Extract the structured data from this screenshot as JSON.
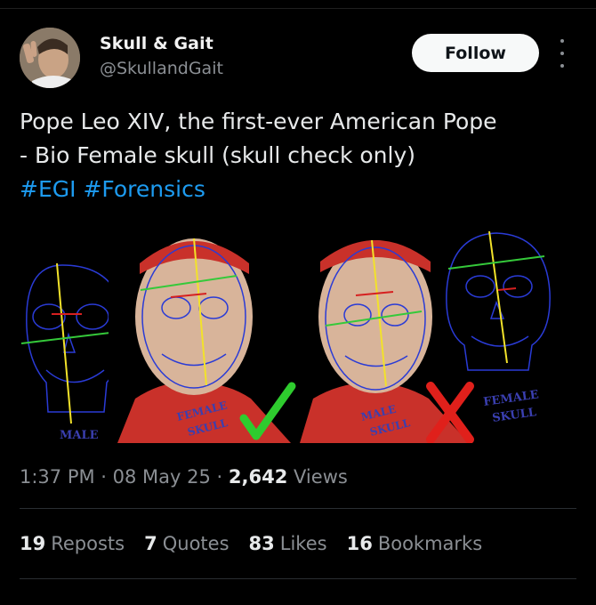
{
  "author": {
    "name": "Skull & Gait",
    "handle": "@SkullandGait"
  },
  "follow_label": "Follow",
  "tweet": {
    "line1": "Pope Leo XIV, the first-ever American Pope",
    "line2": "- Bio Female skull (skull check only)",
    "hashtags": [
      "#EGI",
      "#Forensics"
    ]
  },
  "media": {
    "left_skull_label": "MALE",
    "face1_label_top": "FEMALE",
    "face1_label_bottom": "SKULL",
    "face2_label_top": "MALE",
    "face2_label_bottom": "SKULL",
    "right_skull_label_top": "FEMALE",
    "right_skull_label_bottom": "SKULL",
    "face1_mark": "checkmark",
    "face2_mark": "x-mark",
    "colors": {
      "check": "#2ecc2e",
      "cross": "#e0201b",
      "skull_outline": "#2a3bd6",
      "vertical_line": "#f2e22a",
      "horizontal_line": "#35c93a",
      "cassock": "#c9312a"
    }
  },
  "meta": {
    "time": "1:37 PM",
    "date": "08 May 25",
    "views_count": "2,642",
    "views_label": "Views"
  },
  "stats": {
    "reposts_count": "19",
    "reposts_label": "Reposts",
    "quotes_count": "7",
    "quotes_label": "Quotes",
    "likes_count": "83",
    "likes_label": "Likes",
    "bookmarks_count": "16",
    "bookmarks_label": "Bookmarks"
  }
}
